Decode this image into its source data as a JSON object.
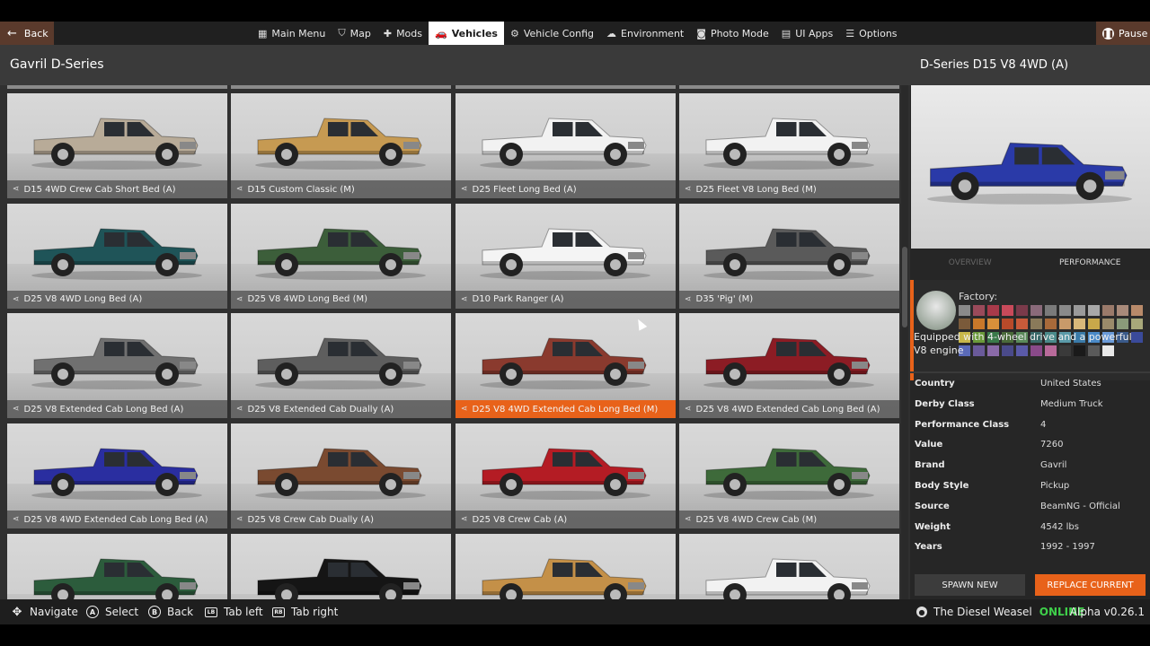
{
  "topbar": {
    "back_label": "Back",
    "pause_label": "Pause",
    "tabs": [
      {
        "label": "Main Menu",
        "icon": "puzzle-grid-icon",
        "active": false
      },
      {
        "label": "Map",
        "icon": "map-icon",
        "active": false
      },
      {
        "label": "Mods",
        "icon": "puzzle-icon",
        "active": false
      },
      {
        "label": "Vehicles",
        "icon": "car-icon",
        "active": true
      },
      {
        "label": "Vehicle Config",
        "icon": "engine-icon",
        "active": false
      },
      {
        "label": "Environment",
        "icon": "weather-icon",
        "active": false
      },
      {
        "label": "Photo Mode",
        "icon": "camera-icon",
        "active": false
      },
      {
        "label": "UI Apps",
        "icon": "apps-icon",
        "active": false
      },
      {
        "label": "Options",
        "icon": "sliders-icon",
        "active": false
      }
    ]
  },
  "list": {
    "title": "Gavril D-Series",
    "cards": [
      {
        "label": "D15 4WD Crew Cab Short Bed (A)",
        "color": "#b8ab98",
        "selected": false
      },
      {
        "label": "D15 Custom Classic (M)",
        "color": "#c69a52",
        "selected": false
      },
      {
        "label": "D25 Fleet Long Bed (A)",
        "color": "#f2f2f2",
        "selected": false
      },
      {
        "label": "D25 Fleet V8 Long Bed (M)",
        "color": "#f2f2f2",
        "selected": false
      },
      {
        "label": "D25 V8 4WD Long Bed (A)",
        "color": "#1f5458",
        "selected": false
      },
      {
        "label": "D25 V8 4WD Long Bed (M)",
        "color": "#3c5e3a",
        "selected": false
      },
      {
        "label": "D10 Park Ranger (A)",
        "color": "#f4f4f4",
        "selected": false
      },
      {
        "label": "D35 'Pig' (M)",
        "color": "#5a5a5a",
        "selected": false
      },
      {
        "label": "D25 V8 Extended Cab Long Bed (A)",
        "color": "#707070",
        "selected": false
      },
      {
        "label": "D25 V8 Extended Cab Dually (A)",
        "color": "#5e5e5e",
        "selected": false
      },
      {
        "label": "D25 V8 4WD Extended Cab Long Bed (M)",
        "color": "#8a3a2e",
        "selected": true
      },
      {
        "label": "D25 V8 4WD Extended Cab Long Bed (A)",
        "color": "#8c1c24",
        "selected": false
      },
      {
        "label": "D25 V8 4WD Extended Cab Long Bed (A)",
        "color": "#2a2ea0",
        "selected": false
      },
      {
        "label": "D25 V8 Crew Cab Dually (A)",
        "color": "#7a4a30",
        "selected": false
      },
      {
        "label": "D25 V8 Crew Cab (A)",
        "color": "#b41c24",
        "selected": false
      },
      {
        "label": "D25 V8 4WD Crew Cab (M)",
        "color": "#3e6a3a",
        "selected": false
      },
      {
        "label": "",
        "color": "#2c5c3c",
        "selected": false
      },
      {
        "label": "",
        "color": "#151515",
        "selected": false
      },
      {
        "label": "",
        "color": "#c49048",
        "selected": false
      },
      {
        "label": "",
        "color": "#f2f2f2",
        "selected": false
      }
    ]
  },
  "detail": {
    "title": "D-Series D15 V8 4WD (A)",
    "tabs": [
      "Overview",
      "Performance"
    ],
    "active_tab": "Performance",
    "preview_color": "#2a3aa8",
    "factory_label": "Factory:",
    "swatches": [
      "#8a8a8a",
      "#9a4a5a",
      "#a83a4a",
      "#c84a5a",
      "#7a3a4a",
      "#8a6a7a",
      "#7a7a7a",
      "#8a8a8a",
      "#9a9a9a",
      "#a8a8a8",
      "#9a7a6a",
      "#a88a7a",
      "#b88a6a",
      "#7a5a3a",
      "#c8782a",
      "#d8903a",
      "#b84a2a",
      "#c85a3a",
      "#8a7a5a",
      "#a86a3a",
      "#c89a6a",
      "#d8b87a",
      "#c8a84a",
      "#9a8a6a",
      "#8a9a7a",
      "#a8a87a",
      "#c8b84a",
      "#6a9a3a",
      "#3a7a4a",
      "#4a6a3a",
      "#5a8a5a",
      "#3a6a6a",
      "#4a8a8a",
      "#5a9aa8",
      "#3a7aa8",
      "#4a8ac8",
      "#6a9ad8",
      "#3a5a8a",
      "#3a4a9a",
      "#5a6ab8",
      "#6a5a9a",
      "#8a6aa8",
      "#4a4a8a",
      "#5a5aa8",
      "#8a4a8a",
      "#b86a9a",
      "#3a3a3a",
      "#1a1a1a",
      "#5a5a5a",
      "#e8e8e8"
    ],
    "description": "Equipped with 4-wheel drive and a powerful V8 engine",
    "specs": [
      {
        "key": "Country",
        "value": "United States"
      },
      {
        "key": "Derby Class",
        "value": "Medium Truck"
      },
      {
        "key": "Performance Class",
        "value": "4"
      },
      {
        "key": "Value",
        "value": "7260"
      },
      {
        "key": "Brand",
        "value": "Gavril"
      },
      {
        "key": "Body Style",
        "value": "Pickup"
      },
      {
        "key": "Source",
        "value": "BeamNG - Official"
      },
      {
        "key": "Weight",
        "value": "4542 lbs"
      },
      {
        "key": "Years",
        "value": "1992 - 1997"
      }
    ],
    "spawn_label": "SPAWN NEW",
    "replace_label": "REPLACE CURRENT"
  },
  "bottombar": {
    "hints": [
      {
        "key": "✥",
        "label": "Navigate"
      },
      {
        "key": "A",
        "label": "Select"
      },
      {
        "key": "B",
        "label": "Back"
      },
      {
        "key": "LB",
        "label": "Tab left"
      },
      {
        "key": "RB",
        "label": "Tab right"
      }
    ],
    "username": "The Diesel Weasel",
    "status": "ONLINE",
    "version": "Alpha v0.26.1"
  }
}
